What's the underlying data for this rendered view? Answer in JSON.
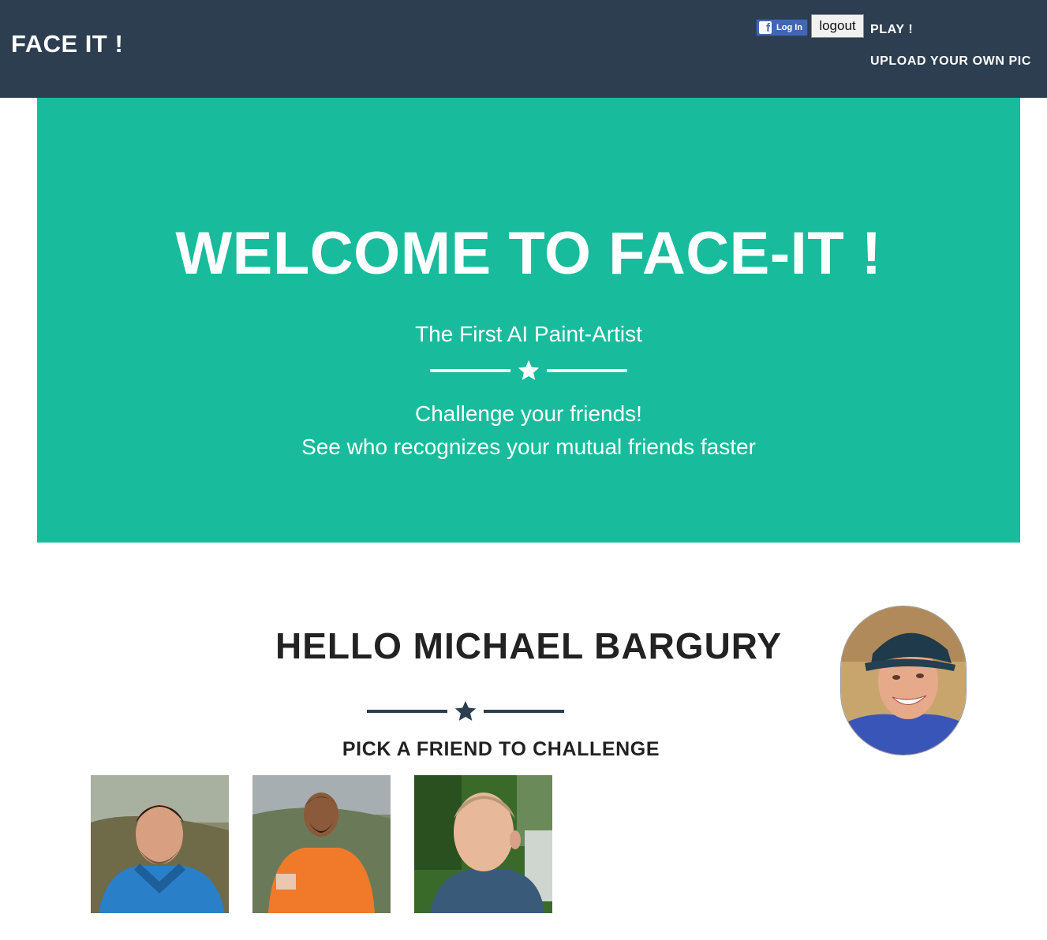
{
  "navbar": {
    "brand": "FACE IT !",
    "fb_login_label": "Log In",
    "fb_logo_glyph": "f",
    "logout_label": "logout",
    "play_label": "PLAY !",
    "upload_label": "UPLOAD YOUR OWN PIC"
  },
  "hero": {
    "title": "WELCOME TO FACE-IT !",
    "subtitle": "The First AI Paint-Artist",
    "line1": "Challenge your friends!",
    "line2": "See who recognizes your mutual friends faster"
  },
  "main": {
    "greeting": "HELLO MICHAEL BARGURY",
    "pick_label": "PICK A FRIEND TO CHALLENGE"
  },
  "colors": {
    "navbar": "#2c3e50",
    "hero": "#18bc9c",
    "text_dark": "#222222",
    "facebook": "#4267b2"
  },
  "icons": [
    "facebook-icon",
    "star-icon"
  ]
}
